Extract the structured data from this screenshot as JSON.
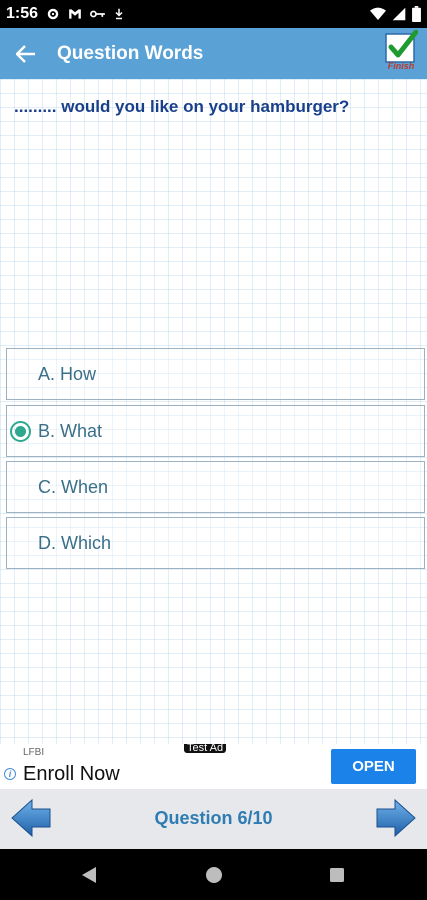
{
  "status_bar": {
    "time": "1:56"
  },
  "app_bar": {
    "title": "Question Words",
    "finish_label": "Finish"
  },
  "question": {
    "text": "......... would you like on your hamburger?"
  },
  "options": [
    {
      "label": "A. How",
      "selected": false
    },
    {
      "label": "B. What",
      "selected": true
    },
    {
      "label": "C. When",
      "selected": false
    },
    {
      "label": "D. Which",
      "selected": false
    }
  ],
  "ad": {
    "badge": "Test Ad",
    "brand": "LFBI",
    "title": "Enroll Now",
    "cta": "OPEN"
  },
  "bottom_nav": {
    "progress": "Question 6/10"
  },
  "colors": {
    "app_bar": "#5aa1d6",
    "accent_radio": "#2fa88f",
    "question_text": "#1a3f8a",
    "ad_cta": "#1a82e8",
    "progress_text": "#2f7cb2"
  }
}
